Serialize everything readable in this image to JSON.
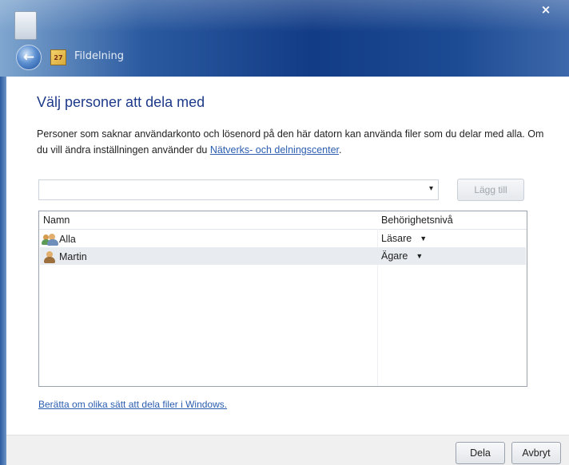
{
  "window": {
    "title": "Fildelning",
    "app_icon_text": "27",
    "close_glyph": "×",
    "back_glyph": "←"
  },
  "heading": "Välj personer att dela med",
  "description": {
    "text": "Personer som saknar användarkonto och lösenord på den här datorn kan använda filer som du delar med alla. Om du vill ändra inställningen använder du ",
    "link": "Nätverks- och delningscenter",
    "suffix": "."
  },
  "combo": {
    "value": "",
    "arrow": "▾"
  },
  "add_button": "Lägg till",
  "table": {
    "headers": [
      "Namn",
      "Behörighetsnivå"
    ],
    "rows": [
      {
        "name": "Alla",
        "permission": "Läsare",
        "icon": "group-users-icon"
      },
      {
        "name": "Martin",
        "permission": "Ägare",
        "icon": "user-icon"
      }
    ],
    "caret": "▼"
  },
  "footer_link": "Berätta om olika sätt att dela filer i Windows.",
  "buttons": {
    "share": "Dela",
    "cancel": "Avbryt"
  }
}
